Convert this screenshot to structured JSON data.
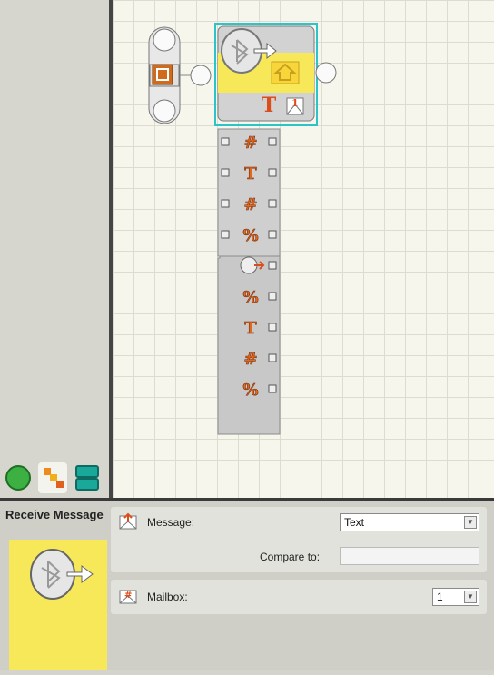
{
  "palette": {
    "tabs": [
      {
        "icon": "green-circle-icon",
        "color": "#3cb043"
      },
      {
        "icon": "orange-blocks-icon",
        "color": "#f08a1c"
      },
      {
        "icon": "teal-stack-icon",
        "color": "#1aa89a"
      }
    ]
  },
  "block": {
    "hub_number": "1",
    "plug_glyphs": [
      "#",
      "T",
      "#",
      "%",
      "bluetooth",
      "%",
      "T",
      "#",
      "%"
    ]
  },
  "config": {
    "title": "Receive Message",
    "message_label": "Message:",
    "message_type": "Text",
    "compare_label": "Compare to:",
    "compare_value": "",
    "mailbox_label": "Mailbox:",
    "mailbox_value": "1"
  },
  "colors": {
    "selection": "#2cc4c8",
    "block_yellow": "#f7e85a",
    "accent_orange": "#e06a1c",
    "plug_gray": "#c4c4c4"
  }
}
